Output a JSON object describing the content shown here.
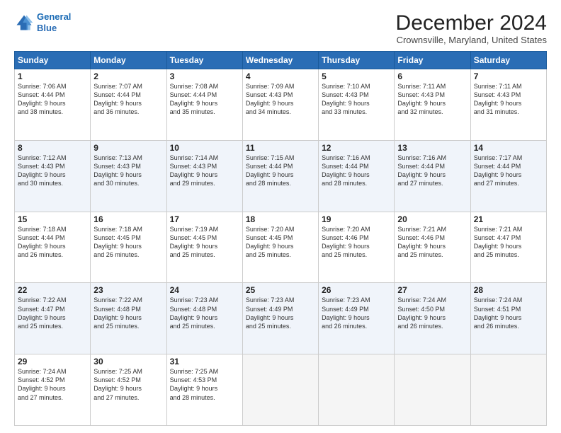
{
  "logo": {
    "line1": "General",
    "line2": "Blue",
    "icon_color": "#2a6db5"
  },
  "title": "December 2024",
  "subtitle": "Crownsville, Maryland, United States",
  "headers": [
    "Sunday",
    "Monday",
    "Tuesday",
    "Wednesday",
    "Thursday",
    "Friday",
    "Saturday"
  ],
  "weeks": [
    [
      {
        "day": "1",
        "info": "Sunrise: 7:06 AM\nSunset: 4:44 PM\nDaylight: 9 hours\nand 38 minutes."
      },
      {
        "day": "2",
        "info": "Sunrise: 7:07 AM\nSunset: 4:44 PM\nDaylight: 9 hours\nand 36 minutes."
      },
      {
        "day": "3",
        "info": "Sunrise: 7:08 AM\nSunset: 4:44 PM\nDaylight: 9 hours\nand 35 minutes."
      },
      {
        "day": "4",
        "info": "Sunrise: 7:09 AM\nSunset: 4:43 PM\nDaylight: 9 hours\nand 34 minutes."
      },
      {
        "day": "5",
        "info": "Sunrise: 7:10 AM\nSunset: 4:43 PM\nDaylight: 9 hours\nand 33 minutes."
      },
      {
        "day": "6",
        "info": "Sunrise: 7:11 AM\nSunset: 4:43 PM\nDaylight: 9 hours\nand 32 minutes."
      },
      {
        "day": "7",
        "info": "Sunrise: 7:11 AM\nSunset: 4:43 PM\nDaylight: 9 hours\nand 31 minutes."
      }
    ],
    [
      {
        "day": "8",
        "info": "Sunrise: 7:12 AM\nSunset: 4:43 PM\nDaylight: 9 hours\nand 30 minutes."
      },
      {
        "day": "9",
        "info": "Sunrise: 7:13 AM\nSunset: 4:43 PM\nDaylight: 9 hours\nand 30 minutes."
      },
      {
        "day": "10",
        "info": "Sunrise: 7:14 AM\nSunset: 4:43 PM\nDaylight: 9 hours\nand 29 minutes."
      },
      {
        "day": "11",
        "info": "Sunrise: 7:15 AM\nSunset: 4:44 PM\nDaylight: 9 hours\nand 28 minutes."
      },
      {
        "day": "12",
        "info": "Sunrise: 7:16 AM\nSunset: 4:44 PM\nDaylight: 9 hours\nand 28 minutes."
      },
      {
        "day": "13",
        "info": "Sunrise: 7:16 AM\nSunset: 4:44 PM\nDaylight: 9 hours\nand 27 minutes."
      },
      {
        "day": "14",
        "info": "Sunrise: 7:17 AM\nSunset: 4:44 PM\nDaylight: 9 hours\nand 27 minutes."
      }
    ],
    [
      {
        "day": "15",
        "info": "Sunrise: 7:18 AM\nSunset: 4:44 PM\nDaylight: 9 hours\nand 26 minutes."
      },
      {
        "day": "16",
        "info": "Sunrise: 7:18 AM\nSunset: 4:45 PM\nDaylight: 9 hours\nand 26 minutes."
      },
      {
        "day": "17",
        "info": "Sunrise: 7:19 AM\nSunset: 4:45 PM\nDaylight: 9 hours\nand 25 minutes."
      },
      {
        "day": "18",
        "info": "Sunrise: 7:20 AM\nSunset: 4:45 PM\nDaylight: 9 hours\nand 25 minutes."
      },
      {
        "day": "19",
        "info": "Sunrise: 7:20 AM\nSunset: 4:46 PM\nDaylight: 9 hours\nand 25 minutes."
      },
      {
        "day": "20",
        "info": "Sunrise: 7:21 AM\nSunset: 4:46 PM\nDaylight: 9 hours\nand 25 minutes."
      },
      {
        "day": "21",
        "info": "Sunrise: 7:21 AM\nSunset: 4:47 PM\nDaylight: 9 hours\nand 25 minutes."
      }
    ],
    [
      {
        "day": "22",
        "info": "Sunrise: 7:22 AM\nSunset: 4:47 PM\nDaylight: 9 hours\nand 25 minutes."
      },
      {
        "day": "23",
        "info": "Sunrise: 7:22 AM\nSunset: 4:48 PM\nDaylight: 9 hours\nand 25 minutes."
      },
      {
        "day": "24",
        "info": "Sunrise: 7:23 AM\nSunset: 4:48 PM\nDaylight: 9 hours\nand 25 minutes."
      },
      {
        "day": "25",
        "info": "Sunrise: 7:23 AM\nSunset: 4:49 PM\nDaylight: 9 hours\nand 25 minutes."
      },
      {
        "day": "26",
        "info": "Sunrise: 7:23 AM\nSunset: 4:49 PM\nDaylight: 9 hours\nand 26 minutes."
      },
      {
        "day": "27",
        "info": "Sunrise: 7:24 AM\nSunset: 4:50 PM\nDaylight: 9 hours\nand 26 minutes."
      },
      {
        "day": "28",
        "info": "Sunrise: 7:24 AM\nSunset: 4:51 PM\nDaylight: 9 hours\nand 26 minutes."
      }
    ],
    [
      {
        "day": "29",
        "info": "Sunrise: 7:24 AM\nSunset: 4:52 PM\nDaylight: 9 hours\nand 27 minutes."
      },
      {
        "day": "30",
        "info": "Sunrise: 7:25 AM\nSunset: 4:52 PM\nDaylight: 9 hours\nand 27 minutes."
      },
      {
        "day": "31",
        "info": "Sunrise: 7:25 AM\nSunset: 4:53 PM\nDaylight: 9 hours\nand 28 minutes."
      },
      {
        "day": "",
        "info": ""
      },
      {
        "day": "",
        "info": ""
      },
      {
        "day": "",
        "info": ""
      },
      {
        "day": "",
        "info": ""
      }
    ]
  ]
}
